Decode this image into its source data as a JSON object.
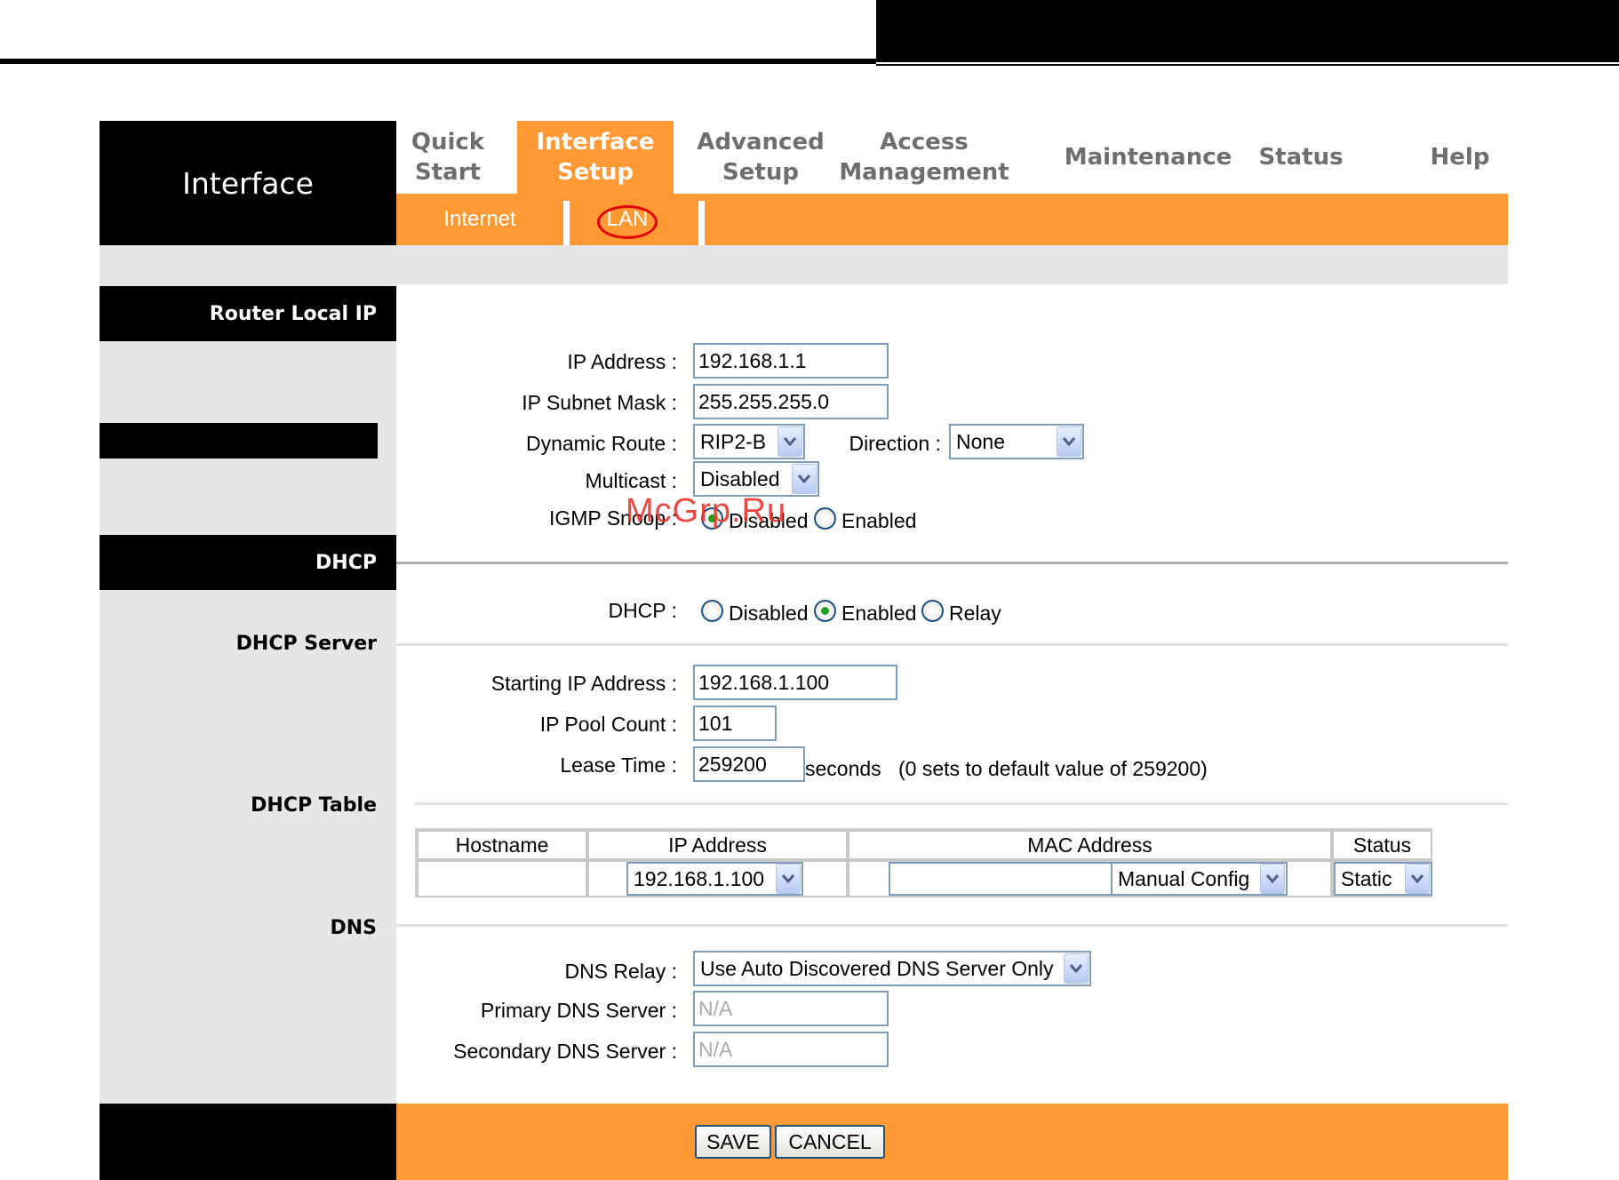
{
  "logo": "Interface",
  "nav": {
    "tabs": [
      {
        "line1": "Quick",
        "line2": "Start"
      },
      {
        "line1": "Interface",
        "line2": "Setup"
      },
      {
        "line1": "Advanced",
        "line2": "Setup"
      },
      {
        "line1": "Access",
        "line2": "Management"
      },
      {
        "line1": "Maintenance",
        "line2": ""
      },
      {
        "line1": "Status",
        "line2": ""
      },
      {
        "line1": "Help",
        "line2": ""
      }
    ],
    "active_tab": "Interface Setup",
    "subtabs": [
      "Internet",
      "LAN"
    ],
    "active_subtab": "LAN"
  },
  "sections": {
    "router_local_ip": "Router Local IP",
    "dhcp": "DHCP",
    "dhcp_server": "DHCP Server",
    "dhcp_table": "DHCP Table",
    "dns": "DNS"
  },
  "router": {
    "ip_label": "IP Address :",
    "ip_value": "192.168.1.1",
    "mask_label": "IP Subnet Mask :",
    "mask_value": "255.255.255.0",
    "dyn_label": "Dynamic Route :",
    "dyn_value": "RIP2-B",
    "dir_label": "Direction :",
    "dir_value": "None",
    "multicast_label": "Multicast :",
    "multicast_value": "Disabled",
    "igmp_label": "IGMP Snoop :",
    "igmp_options": [
      "Disabled",
      "Enabled"
    ],
    "igmp_selected": "Disabled"
  },
  "dhcp": {
    "label": "DHCP :",
    "options": [
      "Disabled",
      "Enabled",
      "Relay"
    ],
    "selected": "Enabled",
    "start_label": "Starting IP Address :",
    "start_value": "192.168.1.100",
    "pool_label": "IP Pool Count :",
    "pool_value": "101",
    "lease_label": "Lease Time :",
    "lease_value": "259200",
    "lease_unit": "seconds",
    "lease_note": "(0 sets to default value of 259200)"
  },
  "dhcp_table": {
    "columns": [
      "Hostname",
      "IP Address",
      "MAC Address",
      "Status"
    ],
    "ip_select": "192.168.1.100",
    "mac_value": "",
    "mac_mode": "Manual Config",
    "status_select": "Static"
  },
  "dns": {
    "relay_label": "DNS Relay :",
    "relay_value": "Use Auto Discovered DNS Server Only",
    "primary_label": "Primary DNS Server :",
    "primary_value": "N/A",
    "secondary_label": "Secondary DNS Server :",
    "secondary_value": "N/A"
  },
  "buttons": {
    "save": "SAVE",
    "cancel": "CANCEL"
  },
  "watermark": "McGrp.Ru",
  "colors": {
    "accent": "#ff9933",
    "header": "#000000",
    "panel": "#e6e6e6",
    "lan_highlight": "#e00000",
    "watermark": "#e8362f"
  }
}
